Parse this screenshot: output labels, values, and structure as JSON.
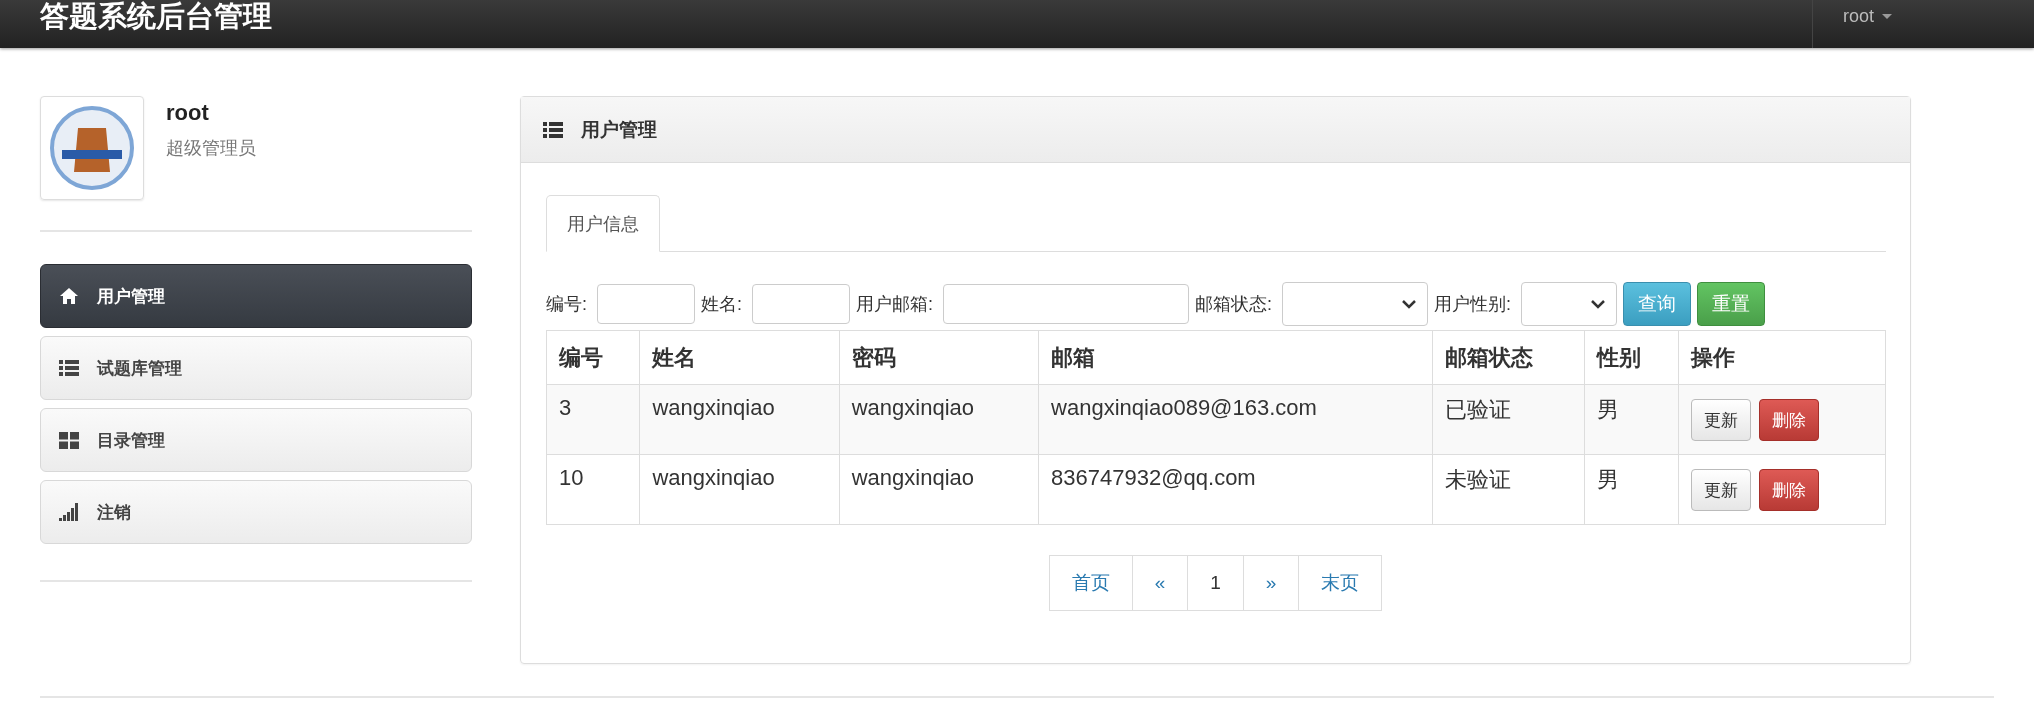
{
  "navbar": {
    "title": "答题系统后台管理",
    "user_menu": "root"
  },
  "profile": {
    "name": "root",
    "role": "超级管理员"
  },
  "sidebar": {
    "items": [
      {
        "label": "用户管理",
        "selected": true
      },
      {
        "label": "试题库管理",
        "selected": false
      },
      {
        "label": "目录管理",
        "selected": false
      },
      {
        "label": "注销",
        "selected": false
      }
    ]
  },
  "panel": {
    "title": "用户管理",
    "tabs": [
      {
        "label": "用户信息",
        "selected": true
      }
    ],
    "filters": [
      {
        "kind": "text",
        "label": "编号:"
      },
      {
        "kind": "text",
        "label": "姓名:"
      },
      {
        "kind": "text",
        "label": "用户邮箱:"
      },
      {
        "kind": "select",
        "label": "邮箱状态:"
      },
      {
        "kind": "select",
        "label": "用户性别:"
      }
    ],
    "buttons": [
      {
        "kind": "info",
        "label": "查询"
      },
      {
        "kind": "success",
        "label": "重置"
      }
    ],
    "table": {
      "columns": [
        "编号",
        "姓名",
        "密码",
        "邮箱",
        "邮箱状态",
        "性别",
        "操作"
      ],
      "rows": [
        {
          "cells": [
            "3",
            "wangxinqiao",
            "wangxinqiao",
            "wangxinqiao089@163.com",
            "已验证",
            "男"
          ],
          "actions": [
            {
              "kind": "default",
              "label": "更新"
            },
            {
              "kind": "danger",
              "label": "删除"
            }
          ]
        },
        {
          "cells": [
            "10",
            "wangxinqiao",
            "wangxinqiao",
            "836747932@qq.com",
            "未验证",
            "男"
          ],
          "actions": [
            {
              "kind": "default",
              "label": "更新"
            },
            {
              "kind": "danger",
              "label": "删除"
            }
          ]
        }
      ]
    },
    "pagination": [
      {
        "label": "首页",
        "selected": false
      },
      {
        "label": "«",
        "selected": false
      },
      {
        "label": "1",
        "selected": true
      },
      {
        "label": "»",
        "selected": false
      },
      {
        "label": "末页",
        "selected": false
      }
    ]
  }
}
